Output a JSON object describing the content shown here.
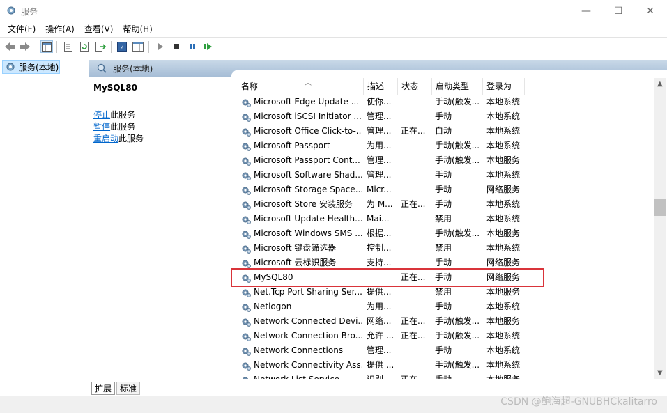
{
  "window": {
    "title": "服务",
    "controls": {
      "min": "—",
      "max": "☐",
      "close": "✕"
    }
  },
  "menu": [
    "文件(F)",
    "操作(A)",
    "查看(V)",
    "帮助(H)"
  ],
  "tree": {
    "item": "服务(本地)"
  },
  "right_pane": {
    "header": "服务(本地)",
    "selected_service": "MySQL80",
    "actions": [
      {
        "link": "停止",
        "rest": "此服务"
      },
      {
        "link": "暂停",
        "rest": "此服务"
      },
      {
        "link": "重启动",
        "rest": "此服务"
      }
    ]
  },
  "table": {
    "columns": {
      "name": "名称",
      "desc": "描述",
      "status": "状态",
      "start": "启动类型",
      "logon": "登录为"
    },
    "rows": [
      {
        "name": "Microsoft Edge Update ...",
        "desc": "使你...",
        "status": "",
        "start": "手动(触发...",
        "logon": "本地系统"
      },
      {
        "name": "Microsoft iSCSI Initiator ...",
        "desc": "管理...",
        "status": "",
        "start": "手动",
        "logon": "本地系统"
      },
      {
        "name": "Microsoft Office Click-to-...",
        "desc": "管理...",
        "status": "正在...",
        "start": "自动",
        "logon": "本地系统"
      },
      {
        "name": "Microsoft Passport",
        "desc": "为用...",
        "status": "",
        "start": "手动(触发...",
        "logon": "本地系统"
      },
      {
        "name": "Microsoft Passport Cont...",
        "desc": "管理...",
        "status": "",
        "start": "手动(触发...",
        "logon": "本地服务"
      },
      {
        "name": "Microsoft Software Shad...",
        "desc": "管理...",
        "status": "",
        "start": "手动",
        "logon": "本地系统"
      },
      {
        "name": "Microsoft Storage Space...",
        "desc": "Micr...",
        "status": "",
        "start": "手动",
        "logon": "网络服务"
      },
      {
        "name": "Microsoft Store 安装服务",
        "desc": "为 M...",
        "status": "正在...",
        "start": "手动",
        "logon": "本地系统"
      },
      {
        "name": "Microsoft Update Health...",
        "desc": "Mai...",
        "status": "",
        "start": "禁用",
        "logon": "本地系统"
      },
      {
        "name": "Microsoft Windows SMS ...",
        "desc": "根据...",
        "status": "",
        "start": "手动(触发...",
        "logon": "本地服务"
      },
      {
        "name": "Microsoft 键盘筛选器",
        "desc": "控制...",
        "status": "",
        "start": "禁用",
        "logon": "本地系统"
      },
      {
        "name": "Microsoft 云标识服务",
        "desc": "支持...",
        "status": "",
        "start": "手动",
        "logon": "网络服务"
      },
      {
        "name": "MySQL80",
        "desc": "",
        "status": "正在...",
        "start": "手动",
        "logon": "网络服务"
      },
      {
        "name": "Net.Tcp Port Sharing Ser...",
        "desc": "提供...",
        "status": "",
        "start": "禁用",
        "logon": "本地服务"
      },
      {
        "name": "Netlogon",
        "desc": "为用...",
        "status": "",
        "start": "手动",
        "logon": "本地系统"
      },
      {
        "name": "Network Connected Devi...",
        "desc": "网络...",
        "status": "正在...",
        "start": "手动(触发...",
        "logon": "本地服务"
      },
      {
        "name": "Network Connection Bro...",
        "desc": "允许 ...",
        "status": "正在...",
        "start": "手动(触发...",
        "logon": "本地系统"
      },
      {
        "name": "Network Connections",
        "desc": "管理...",
        "status": "",
        "start": "手动",
        "logon": "本地系统"
      },
      {
        "name": "Network Connectivity Ass...",
        "desc": "提供 ...",
        "status": "",
        "start": "手动(触发...",
        "logon": "本地系统"
      },
      {
        "name": "Network List Service",
        "desc": "识别...",
        "status": "正在...",
        "start": "手动",
        "logon": "本地服务"
      }
    ]
  },
  "bottom_tabs": [
    "扩展",
    "标准"
  ],
  "watermark": "CSDN @鲍海超-GNUBHCkalitarro",
  "colors": {
    "highlight_border": "#d9343a",
    "link": "#0066cc",
    "header_bg": "#b6c9dd"
  }
}
